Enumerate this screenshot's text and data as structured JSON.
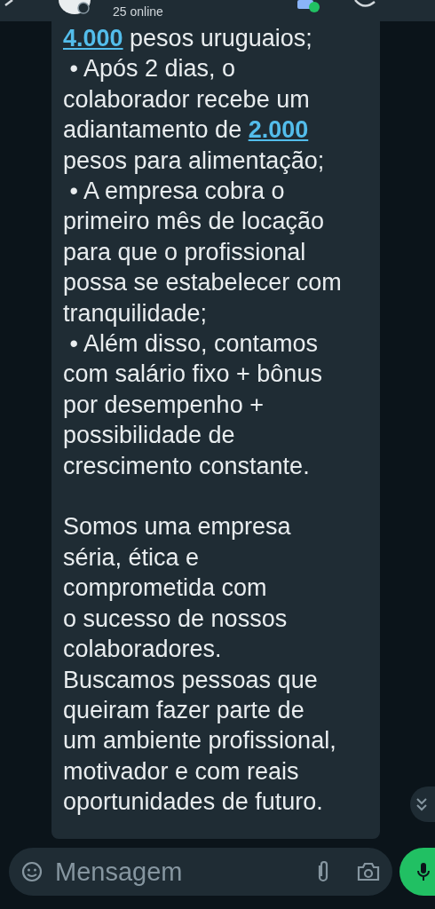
{
  "header": {
    "status": "25 online"
  },
  "message": {
    "paragraphs": [
      {
        "lines": [
          [
            {
              "text": "4.000",
              "link": true
            },
            {
              "text": " pesos uruguaios;",
              "link": false
            }
          ],
          [
            {
              "text": " • Após 2 dias, o",
              "link": false
            }
          ],
          [
            {
              "text": "colaborador recebe um",
              "link": false
            }
          ],
          [
            {
              "text": "adiantamento de ",
              "link": false
            },
            {
              "text": "2.000",
              "link": true
            }
          ],
          [
            {
              "text": "pesos para alimentação;",
              "link": false
            }
          ],
          [
            {
              "text": " • A empresa cobra o",
              "link": false
            }
          ],
          [
            {
              "text": "primeiro mês de locação",
              "link": false
            }
          ],
          [
            {
              "text": "para que o profissional",
              "link": false
            }
          ],
          [
            {
              "text": "possa se estabelecer com",
              "link": false
            }
          ],
          [
            {
              "text": "tranquilidade;",
              "link": false
            }
          ],
          [
            {
              "text": " • Além disso, contamos",
              "link": false
            }
          ],
          [
            {
              "text": "com salário fixo + bônus",
              "link": false
            }
          ],
          [
            {
              "text": "por desempenho +",
              "link": false
            }
          ],
          [
            {
              "text": "possibilidade de",
              "link": false
            }
          ],
          [
            {
              "text": "crescimento constante.",
              "link": false
            }
          ]
        ]
      },
      {
        "lines": [
          [
            {
              "text": "Somos uma empresa",
              "link": false
            }
          ],
          [
            {
              "text": "séria, ética e",
              "link": false
            }
          ],
          [
            {
              "text": "comprometida com",
              "link": false
            }
          ],
          [
            {
              "text": "o sucesso de nossos",
              "link": false
            }
          ],
          [
            {
              "text": "colaboradores.",
              "link": false
            }
          ],
          [
            {
              "text": "Buscamos pessoas que",
              "link": false
            }
          ],
          [
            {
              "text": "queiram fazer parte de",
              "link": false
            }
          ],
          [
            {
              "text": "um ambiente profissional,",
              "link": false
            }
          ],
          [
            {
              "text": "motivador e com reais",
              "link": false
            }
          ],
          [
            {
              "text": "oportunidades de futuro.",
              "link": false
            }
          ]
        ]
      }
    ]
  },
  "composer": {
    "placeholder": "Mensagem"
  }
}
